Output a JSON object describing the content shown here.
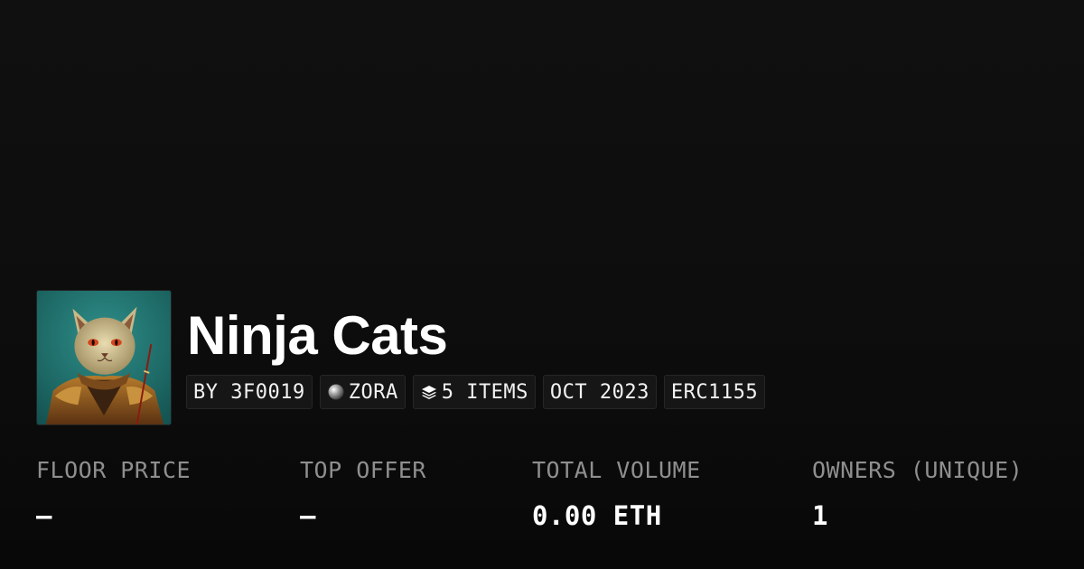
{
  "collection": {
    "name": "Ninja Cats",
    "avatar_alt": "ninja-cat-portrait"
  },
  "tags": {
    "creator": "BY 3F0019",
    "chain": "ZORA",
    "items": "5 ITEMS",
    "date": "OCT 2023",
    "standard": "ERC1155"
  },
  "stats": {
    "floor_price": {
      "label": "FLOOR PRICE",
      "value": "–"
    },
    "top_offer": {
      "label": "TOP OFFER",
      "value": "–"
    },
    "total_volume": {
      "label": "TOTAL VOLUME",
      "value": "0.00 ETH"
    },
    "owners": {
      "label": "OWNERS (UNIQUE)",
      "value": "1"
    }
  },
  "icons": {
    "chain": "zora-orb-icon",
    "items": "layers-icon"
  }
}
